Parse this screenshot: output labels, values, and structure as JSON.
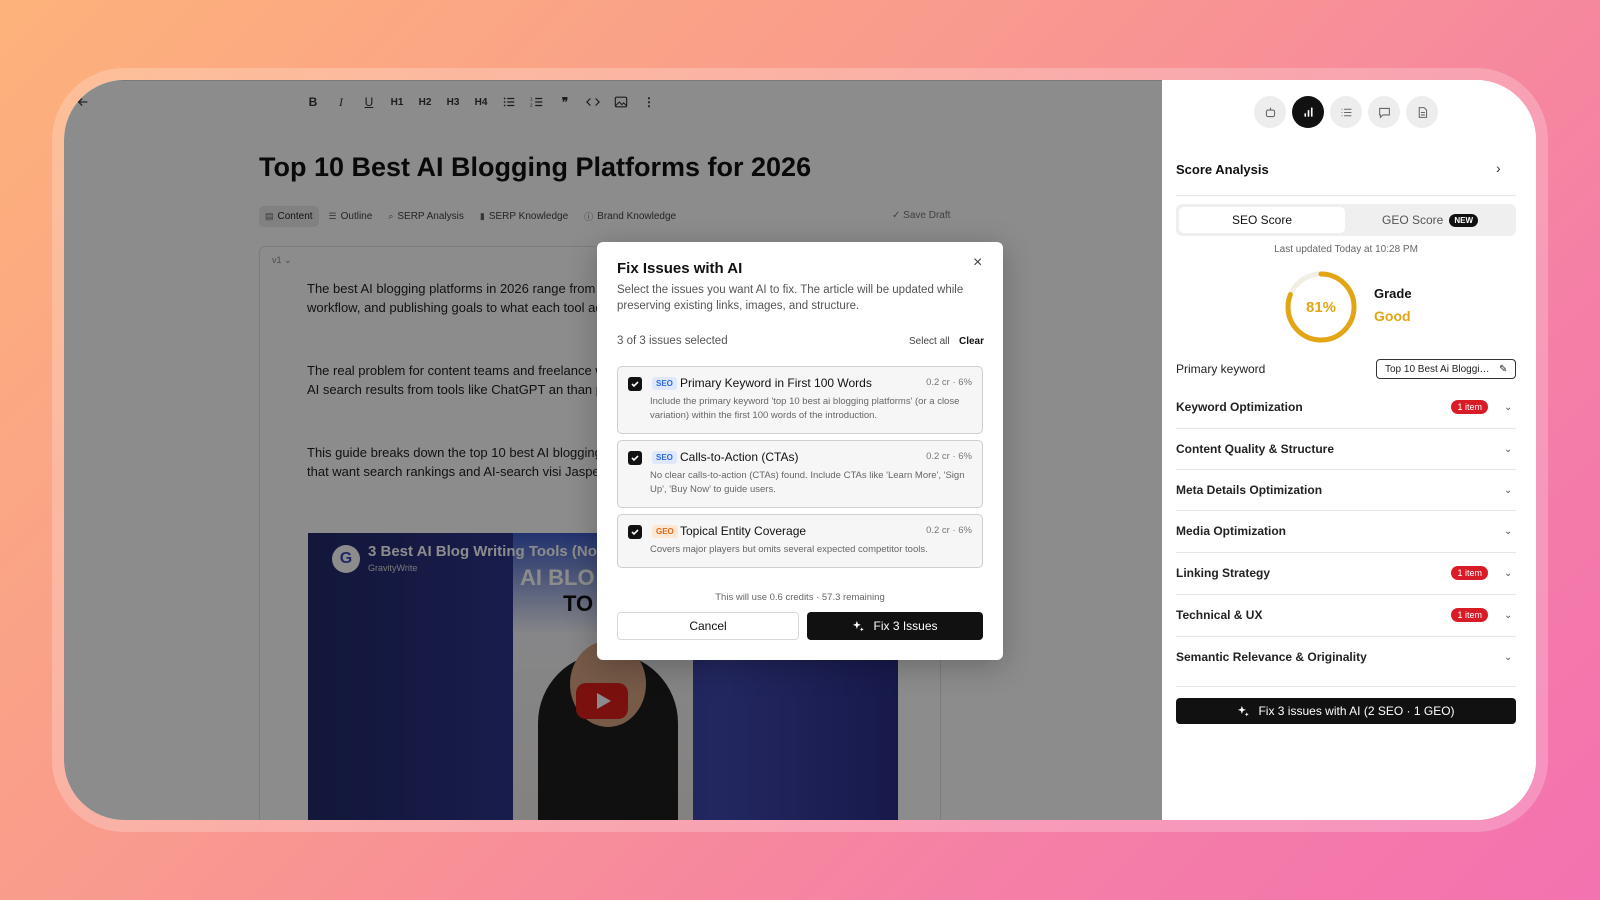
{
  "toolbar": {
    "buttons": [
      "back-icon",
      "bold-icon",
      "italic-icon",
      "underline-icon",
      "h1-icon",
      "h2-icon",
      "h3-icon",
      "h4-icon",
      "bullet-list-icon",
      "numbered-list-icon",
      "quote-icon",
      "code-icon",
      "image-icon",
      "more-icon"
    ],
    "h1": "H1",
    "h2": "H2",
    "h3": "H3",
    "h4": "H4"
  },
  "editor": {
    "title": "Top 10 Best AI Blogging Platforms for 2026",
    "tabs": [
      {
        "label": "Content",
        "icon": "doc-icon"
      },
      {
        "label": "Outline",
        "icon": "outline-icon"
      },
      {
        "label": "SERP Analysis",
        "icon": "search-icon"
      },
      {
        "label": "SERP Knowledge",
        "icon": "bar-chart-icon"
      },
      {
        "label": "Brand Knowledge",
        "icon": "info-icon"
      }
    ],
    "save_draft": "✓ Save Draft",
    "version": "v1 ⌄",
    "paragraphs": [
      "The best AI blogging platforms in 2026 range from a like Jasper AI, Surfer SEO, and Koala AI, and pickin workflow, and publishing goals to what each tool act wastes hours, especially when most roundups repea",
      "The real problem for content teams and freelance w ready to publish, and which ones need a full rewrite toward AI search results from tools like ChatGPT an than picking whichever homepage looks the flashie",
      "This guide breaks down the top 10 best AI blogging features, workflow fit, and pricing so you can match teams that want search rankings and AI-search visi Jasper AI, Surfer SEO, and AIOSEO."
    ],
    "video": {
      "title": "3 Best AI Blog Writing Tools (No",
      "channel": "GravityWrite",
      "overlay_line1": "AI BLO",
      "overlay_line2": "TO"
    }
  },
  "panel": {
    "icons": [
      "robot-icon",
      "bar-chart-icon",
      "list-icon",
      "comment-icon",
      "document-icon"
    ],
    "heading": "Score Analysis",
    "tabs": {
      "seo": "SEO Score",
      "geo": "GEO Score",
      "new_badge": "NEW"
    },
    "updated": "Last updated Today at 10:28 PM",
    "score": {
      "value": 81,
      "label": "81%",
      "grade_label": "Grade",
      "grade": "Good",
      "color": "#e2a614"
    },
    "primary_keyword_label": "Primary keyword",
    "primary_keyword": "Top 10 Best Ai Bloggin...",
    "sections": [
      {
        "label": "Keyword Optimization",
        "badge": "1 item"
      },
      {
        "label": "Content Quality & Structure",
        "badge": ""
      },
      {
        "label": "Meta Details Optimization",
        "badge": ""
      },
      {
        "label": "Media Optimization",
        "badge": ""
      },
      {
        "label": "Linking Strategy",
        "badge": "1 item"
      },
      {
        "label": "Technical & UX",
        "badge": "1 item"
      },
      {
        "label": "Semantic Relevance & Originality",
        "badge": ""
      }
    ],
    "fix_all": "Fix 3 issues with AI (2 SEO · 1 GEO)"
  },
  "modal": {
    "title": "Fix Issues with AI",
    "description": "Select the issues you want AI to fix. The article will be updated while preserving existing links, images, and structure.",
    "count": "3 of 3 issues selected",
    "select_all": "Select all",
    "clear": "Clear",
    "issues": [
      {
        "tag": "SEO",
        "title": "Primary Keyword in First 100 Words",
        "cost": "0.2 cr · 6%",
        "desc": "Include the primary keyword 'top 10 best ai blogging platforms' (or a close variation) within the first 100 words of the introduction.",
        "checked": true
      },
      {
        "tag": "SEO",
        "title": "Calls-to-Action (CTAs)",
        "cost": "0.2 cr · 6%",
        "desc": "No clear calls-to-action (CTAs) found. Include CTAs like 'Learn More', 'Sign Up', 'Buy Now' to guide users.",
        "checked": true
      },
      {
        "tag": "GEO",
        "title": "Topical Entity Coverage",
        "cost": "0.2 cr · 6%",
        "desc": "Covers major players but omits several expected competitor tools.",
        "checked": true
      }
    ],
    "credits": "This will use 0.6 credits · 57.3 remaining",
    "cancel": "Cancel",
    "fix": "Fix 3 Issues"
  }
}
